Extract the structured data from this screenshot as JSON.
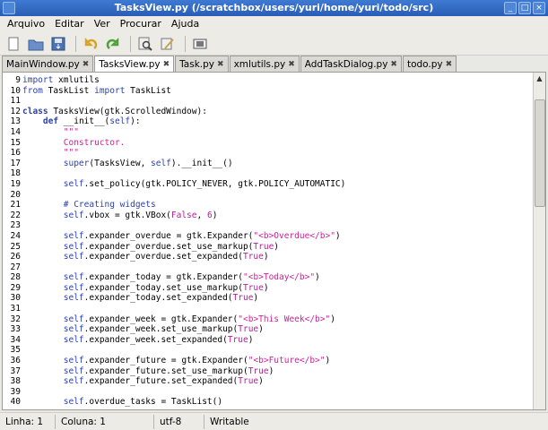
{
  "window": {
    "title": "TasksView.py (/scratchbox/users/yuri/home/yuri/todo/src)"
  },
  "menu": [
    {
      "label": "Arquivo"
    },
    {
      "label": "Editar"
    },
    {
      "label": "Ver"
    },
    {
      "label": "Procurar"
    },
    {
      "label": "Ajuda"
    }
  ],
  "toolbar": [
    "new-file-icon",
    "open-file-icon",
    "save-file-icon",
    "undo-icon",
    "redo-icon",
    "find-icon",
    "preferences-icon",
    "fullscreen-icon"
  ],
  "tabs": [
    {
      "label": "MainWindow.py"
    },
    {
      "label": "TasksView.py"
    },
    {
      "label": "Task.py"
    },
    {
      "label": "xmlutils.py"
    },
    {
      "label": "AddTaskDialog.py"
    },
    {
      "label": "todo.py"
    }
  ],
  "code": [
    {
      "n": "9",
      "segs": [
        [
          "kw",
          "import"
        ],
        [
          "plain",
          " xmlutils"
        ]
      ]
    },
    {
      "n": "10",
      "segs": [
        [
          "kw",
          "from"
        ],
        [
          "plain",
          " TaskList "
        ],
        [
          "kw",
          "import"
        ],
        [
          "plain",
          " TaskList"
        ]
      ]
    },
    {
      "n": "11",
      "segs": []
    },
    {
      "n": "12",
      "segs": [
        [
          "kwb",
          "class"
        ],
        [
          "plain",
          " TasksView(gtk.ScrolledWindow):"
        ]
      ]
    },
    {
      "n": "13",
      "segs": [
        [
          "plain",
          "    "
        ],
        [
          "kwb",
          "def"
        ],
        [
          "plain",
          " __init__("
        ],
        [
          "kw",
          "self"
        ],
        [
          "plain",
          "):"
        ]
      ]
    },
    {
      "n": "14",
      "segs": [
        [
          "plain",
          "        "
        ],
        [
          "str",
          "\"\"\""
        ]
      ]
    },
    {
      "n": "15",
      "segs": [
        [
          "plain",
          "        "
        ],
        [
          "str",
          "Constructor."
        ]
      ]
    },
    {
      "n": "16",
      "segs": [
        [
          "plain",
          "        "
        ],
        [
          "str",
          "\"\"\""
        ]
      ]
    },
    {
      "n": "17",
      "segs": [
        [
          "plain",
          "        "
        ],
        [
          "kw",
          "super"
        ],
        [
          "plain",
          "(TasksView, "
        ],
        [
          "kw",
          "self"
        ],
        [
          "plain",
          ").__init__()"
        ]
      ]
    },
    {
      "n": "18",
      "segs": []
    },
    {
      "n": "19",
      "segs": [
        [
          "plain",
          "        "
        ],
        [
          "kw",
          "self"
        ],
        [
          "plain",
          ".set_policy(gtk.POLICY_NEVER, gtk.POLICY_AUTOMATIC)"
        ]
      ]
    },
    {
      "n": "20",
      "segs": []
    },
    {
      "n": "21",
      "segs": [
        [
          "plain",
          "        "
        ],
        [
          "cm",
          "# Creating widgets"
        ]
      ]
    },
    {
      "n": "22",
      "segs": [
        [
          "plain",
          "        "
        ],
        [
          "kw",
          "self"
        ],
        [
          "plain",
          ".vbox = gtk.VBox("
        ],
        [
          "bool",
          "False"
        ],
        [
          "plain",
          ", "
        ],
        [
          "num",
          "6"
        ],
        [
          "plain",
          ")"
        ]
      ]
    },
    {
      "n": "23",
      "segs": []
    },
    {
      "n": "24",
      "segs": [
        [
          "plain",
          "        "
        ],
        [
          "kw",
          "self"
        ],
        [
          "plain",
          ".expander_overdue = gtk.Expander("
        ],
        [
          "str",
          "\"<b>Overdue</b>\""
        ],
        [
          "plain",
          ")"
        ]
      ]
    },
    {
      "n": "25",
      "segs": [
        [
          "plain",
          "        "
        ],
        [
          "kw",
          "self"
        ],
        [
          "plain",
          ".expander_overdue.set_use_markup("
        ],
        [
          "bool",
          "True"
        ],
        [
          "plain",
          ")"
        ]
      ]
    },
    {
      "n": "26",
      "segs": [
        [
          "plain",
          "        "
        ],
        [
          "kw",
          "self"
        ],
        [
          "plain",
          ".expander_overdue.set_expanded("
        ],
        [
          "bool",
          "True"
        ],
        [
          "plain",
          ")"
        ]
      ]
    },
    {
      "n": "27",
      "segs": []
    },
    {
      "n": "28",
      "segs": [
        [
          "plain",
          "        "
        ],
        [
          "kw",
          "self"
        ],
        [
          "plain",
          ".expander_today = gtk.Expander("
        ],
        [
          "str",
          "\"<b>Today</b>\""
        ],
        [
          "plain",
          ")"
        ]
      ]
    },
    {
      "n": "29",
      "segs": [
        [
          "plain",
          "        "
        ],
        [
          "kw",
          "self"
        ],
        [
          "plain",
          ".expander_today.set_use_markup("
        ],
        [
          "bool",
          "True"
        ],
        [
          "plain",
          ")"
        ]
      ]
    },
    {
      "n": "30",
      "segs": [
        [
          "plain",
          "        "
        ],
        [
          "kw",
          "self"
        ],
        [
          "plain",
          ".expander_today.set_expanded("
        ],
        [
          "bool",
          "True"
        ],
        [
          "plain",
          ")"
        ]
      ]
    },
    {
      "n": "31",
      "segs": []
    },
    {
      "n": "32",
      "segs": [
        [
          "plain",
          "        "
        ],
        [
          "kw",
          "self"
        ],
        [
          "plain",
          ".expander_week = gtk.Expander("
        ],
        [
          "str",
          "\"<b>This Week</b>\""
        ],
        [
          "plain",
          ")"
        ]
      ]
    },
    {
      "n": "33",
      "segs": [
        [
          "plain",
          "        "
        ],
        [
          "kw",
          "self"
        ],
        [
          "plain",
          ".expander_week.set_use_markup("
        ],
        [
          "bool",
          "True"
        ],
        [
          "plain",
          ")"
        ]
      ]
    },
    {
      "n": "34",
      "segs": [
        [
          "plain",
          "        "
        ],
        [
          "kw",
          "self"
        ],
        [
          "plain",
          ".expander_week.set_expanded("
        ],
        [
          "bool",
          "True"
        ],
        [
          "plain",
          ")"
        ]
      ]
    },
    {
      "n": "35",
      "segs": []
    },
    {
      "n": "36",
      "segs": [
        [
          "plain",
          "        "
        ],
        [
          "kw",
          "self"
        ],
        [
          "plain",
          ".expander_future = gtk.Expander("
        ],
        [
          "str",
          "\"<b>Future</b>\""
        ],
        [
          "plain",
          ")"
        ]
      ]
    },
    {
      "n": "37",
      "segs": [
        [
          "plain",
          "        "
        ],
        [
          "kw",
          "self"
        ],
        [
          "plain",
          ".expander_future.set_use_markup("
        ],
        [
          "bool",
          "True"
        ],
        [
          "plain",
          ")"
        ]
      ]
    },
    {
      "n": "38",
      "segs": [
        [
          "plain",
          "        "
        ],
        [
          "kw",
          "self"
        ],
        [
          "plain",
          ".expander_future.set_expanded("
        ],
        [
          "bool",
          "True"
        ],
        [
          "plain",
          ")"
        ]
      ]
    },
    {
      "n": "39",
      "segs": []
    },
    {
      "n": "40",
      "segs": [
        [
          "plain",
          "        "
        ],
        [
          "kw",
          "self"
        ],
        [
          "plain",
          ".overdue_tasks = TaskList()"
        ]
      ]
    }
  ],
  "status": {
    "line": "Linha: 1",
    "column": "Coluna: 1",
    "encoding": "utf-8",
    "mode": "Writable"
  }
}
